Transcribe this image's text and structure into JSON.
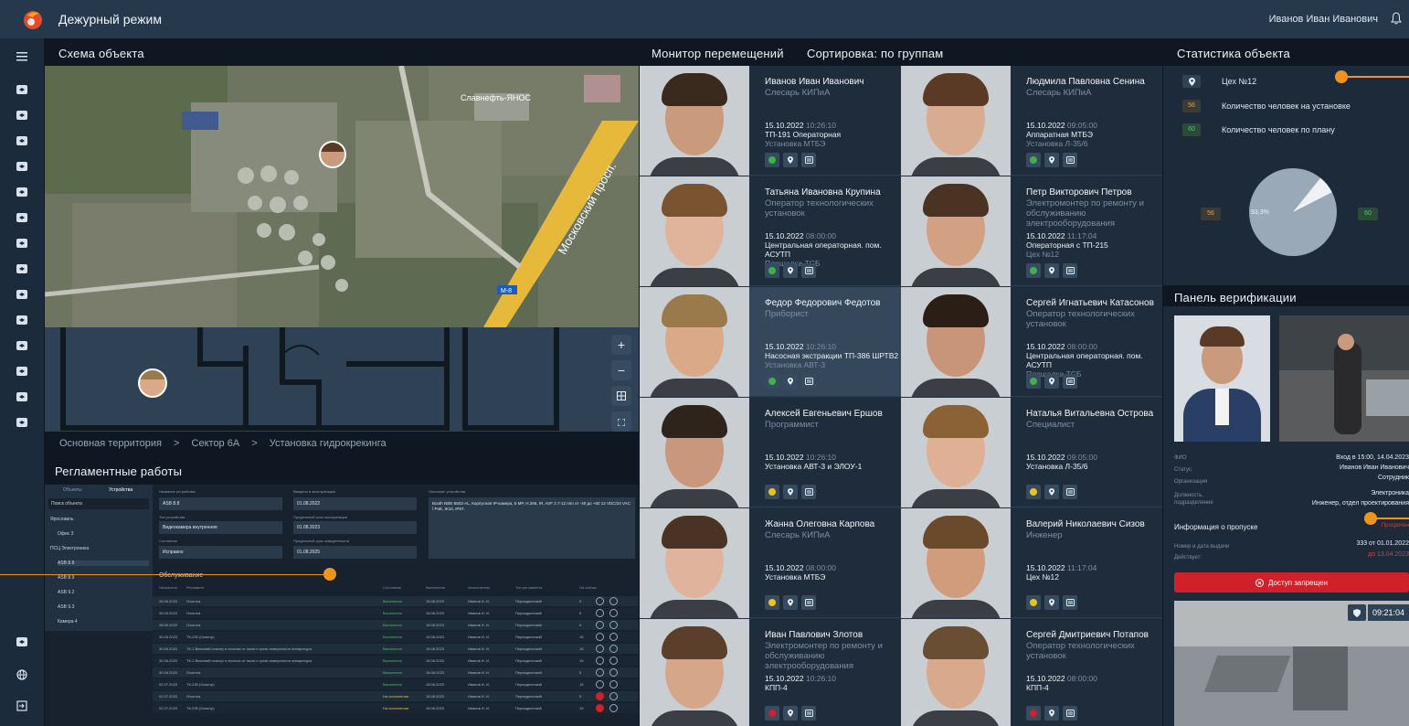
{
  "app": {
    "title": "Дежурный режим",
    "user": "Иванов Иван Иванович"
  },
  "scheme": {
    "title": "Схема объекта",
    "map_label_1": "Славнефть-ЯНОС",
    "map_label_2": "Московский просп.",
    "map_label_3": "М-8",
    "breadcrumb": [
      "Основная территория",
      ">",
      "Сектор 6А",
      ">",
      "Установка гидрокрекинга"
    ]
  },
  "zoom": {
    "plus": "+",
    "minus": "−"
  },
  "regl": {
    "title": "Регламентные работы",
    "tabs": [
      "Объекты",
      "Устройства"
    ],
    "search_placeholder": "Поиск объекта",
    "tree": [
      "Ярославль",
      "Офис 3",
      "ПСЦ Электроника",
      "ASB 8.8",
      "ASB 8.9",
      "ASB 9.2",
      "ASB 9.3",
      "Камера 4"
    ],
    "fields": {
      "name_label": "Название устройства",
      "name_value": "ASB 8.8",
      "type_label": "Тип устройства",
      "type_value": "Видеокамера внутренняя",
      "state_label": "Состояние",
      "state_value": "Исправно",
      "date_in_label": "Введено в эксплуатацию",
      "date_in_value": "01.08.2022",
      "date_lim_label": "Предельный срок эксплуатации",
      "date_lim_value": "01.08.2023",
      "date_rev_label": "Предельный срок освидетельств",
      "date_rev_value": "01.08.2025",
      "desc_label": "Описание устройства",
      "desc_value": "Booth NBE-5502-AL, Корпусная IP-камера, 5 MP, H.265, IR, AVF 2.7-12 mm от -40 до +60 12 VDC/24 VAC / PoE, IK10, IP67."
    },
    "service_title": "Обслуживание",
    "headers": [
      "Назначено",
      "Регламент",
      "Состояние",
      "Выполнено",
      "Исполнитель",
      "Тип регламента",
      "На сейчас"
    ],
    "rows": [
      [
        "28.06.2023",
        "Очистка",
        "Выполнено",
        "18.08.2023",
        "Иванов И. И.",
        "Периодический",
        "5"
      ],
      [
        "28.06.2023",
        "Очистка",
        "Выполнено",
        "18.08.2023",
        "Иванов И. И.",
        "Периодический",
        "5"
      ],
      [
        "28.06.2023",
        "Очистка",
        "Выполнено",
        "18.08.2023",
        "Иванов И. И.",
        "Периодический",
        "5"
      ],
      [
        "30.06.2023",
        "ТК-235 (Осмотр)",
        "Выполнено",
        "18.08.2023",
        "Иванов И. И.",
        "Периодический",
        "15"
      ],
      [
        "30.06.2023",
        "ТК-1 Внешний осмотр и очистка от пыли и грязи поверхности аппаратуры",
        "Выполнено",
        "18.08.2023",
        "Иванов И. И.",
        "Периодический",
        "15"
      ],
      [
        "30.06.2023",
        "ТК-1 Внешний осмотр и очистка от пыли и грязи поверхности аппаратуры",
        "Выполнено",
        "18.08.2023",
        "Иванов И. И.",
        "Периодический",
        "15"
      ],
      [
        "30.06.2023",
        "Очистка",
        "Выполнено",
        "18.08.2023",
        "Иванов И. И.",
        "Периодический",
        "5"
      ],
      [
        "02.07.2023",
        "ТК-235 (Осмотр)",
        "Выполнено",
        "18.08.2023",
        "Иванов И. И.",
        "Периодический",
        "15"
      ],
      [
        "02.07.2023",
        "Очистка",
        "На исполнении",
        "18.08.2023",
        "Иванов И. И.",
        "Периодический",
        "5"
      ],
      [
        "02.07.2023",
        "ТК-235 (Осмотр)",
        "На исполнении",
        "18.08.2023",
        "Иванов И. И.",
        "Периодический",
        "15"
      ]
    ]
  },
  "monitor": {
    "title": "Монитор перемещений",
    "sort": "Сортировка: по группам",
    "cards": [
      {
        "name": "Иванов Иван Иванович",
        "pos": "Слесарь КИПиА",
        "date": "15.10.2022",
        "time": "10:26:10",
        "loc1": "ТП-191 Операторная",
        "loc2": "Установка МТБЭ",
        "status": "#3fb04a",
        "skin": "#c99a7b",
        "hair": "#3a2a1e"
      },
      {
        "name": "Людмила Павловна Сенина",
        "pos": "Слесарь КИПиА",
        "date": "15.10.2022",
        "time": "09:05:00",
        "loc1": "Аппаратная МТБЭ",
        "loc2": "Установка Л-35/6",
        "status": "#3fb04a",
        "skin": "#d8ac90",
        "hair": "#5a3a24"
      },
      {
        "name": "Татьяна Ивановна Крупина",
        "pos": "Оператор технологических установок",
        "date": "15.10.2022",
        "time": "08:00:00",
        "loc1": "Центральная операторная. пом. АСУТП",
        "loc2": "Площадка ТСБ",
        "status": "#3fb04a",
        "skin": "#e0b49a",
        "hair": "#7a5330"
      },
      {
        "name": "Петр Викторович Петров",
        "pos": "Электромонтер по ремонту и обслуживанию электрооборудования",
        "date": "15.10.2022",
        "time": "11:17:04",
        "loc1": "Операторная с ТП-215",
        "loc2": "Цех №12",
        "status": "#3fb04a",
        "skin": "#d2a183",
        "hair": "#4a3322"
      },
      {
        "name": "Федор Федорович Федотов",
        "pos": "Приборист",
        "date": "15.10.2022",
        "time": "10:26:10",
        "loc1": "Насосная экстракции ТП-386 ШРТВ2",
        "loc2": "Установка АВТ-3",
        "status": "#3fb04a",
        "skin": "#d9a988",
        "hair": "#9a7a4a"
      },
      {
        "name": "Сергей Игнатьевич Катасонов",
        "pos": "Оператор технологических установок",
        "date": "15.10.2022",
        "time": "08:00:00",
        "loc1": "Центральная операторная. пом. АСУТП",
        "loc2": "Площадка ТСБ",
        "status": "#3fb04a",
        "skin": "#c8957a",
        "hair": "#2a1e16"
      },
      {
        "name": "Алексей Евгеньевич Ершов",
        "pos": "Программист",
        "date": "15.10.2022",
        "time": "10:26:10",
        "loc1": "Установка АВТ-3 и ЭЛОУ-1",
        "loc2": "",
        "status": "#e8c421",
        "skin": "#c9987c",
        "hair": "#2f241c"
      },
      {
        "name": "Наталья Витальевна Острова",
        "pos": "Специалист",
        "date": "15.10.2022",
        "time": "09:05:00",
        "loc1": "Установка Л-35/6",
        "loc2": "",
        "status": "#e8c421",
        "skin": "#dfb095",
        "hair": "#8a6236"
      },
      {
        "name": "Жанна Олеговна Карпова",
        "pos": "Слесарь КИПиА",
        "date": "15.10.2022",
        "time": "08:00:00",
        "loc1": "Установка МТБЭ",
        "loc2": "",
        "status": "#e8c421",
        "skin": "#e0b39c",
        "hair": "#4a3224"
      },
      {
        "name": "Валерий Николаевич Сизов",
        "pos": "Инженер",
        "date": "15.10.2022",
        "time": "11:17:04",
        "loc1": "Цех №12",
        "loc2": "",
        "status": "#e8c421",
        "skin": "#d19c7c",
        "hair": "#6b4a2c"
      },
      {
        "name": "Иван Павлович Злотов",
        "pos": "Электромонтер по ремонту и обслуживанию электрооборудования",
        "date": "15.10.2022",
        "time": "10:26:10",
        "loc1": "КПП-4",
        "loc2": "",
        "status": "#d0212b",
        "skin": "#d6a689",
        "hair": "#5b3f2a"
      },
      {
        "name": "Сергей Дмитриевич Потапов",
        "pos": "Оператор технологических установок",
        "date": "15.10.2022",
        "time": "08:00:00",
        "loc1": "КПП-4",
        "loc2": "",
        "status": "#d0212b",
        "skin": "#d8a98c",
        "hair": "#6a4e34"
      }
    ]
  },
  "stats": {
    "title": "Статистика объекта",
    "rows": [
      {
        "badge": "",
        "label": "Цех №12"
      },
      {
        "badge": "56",
        "label": "Количество человек на установке"
      },
      {
        "badge": "60",
        "label": "Количество человек по плану"
      }
    ],
    "left_badge": "56",
    "right_badge": "60",
    "pct": "93,3%",
    "fraction": 0.933
  },
  "verify": {
    "title": "Панель верификации",
    "labels": [
      "ФИО",
      "Статус",
      "Организация",
      "Должность, подразделение"
    ],
    "values": [
      "Вход  в 15:00, 14.04.2023",
      "Иванов Иван Иванович",
      "Сотрудник",
      "Электроника",
      "Инженер, отдел проектирования"
    ],
    "pass_title": "Информация о пропуске",
    "pass_status": "Просрочен",
    "pass_labels": [
      "Номер и дата выдачи",
      "Действует:"
    ],
    "pass_values": [
      "333 от 01.01.2022",
      "до 13.04.2023"
    ],
    "deny": "Доступ запрещен",
    "cam_time": "09:21:04"
  }
}
